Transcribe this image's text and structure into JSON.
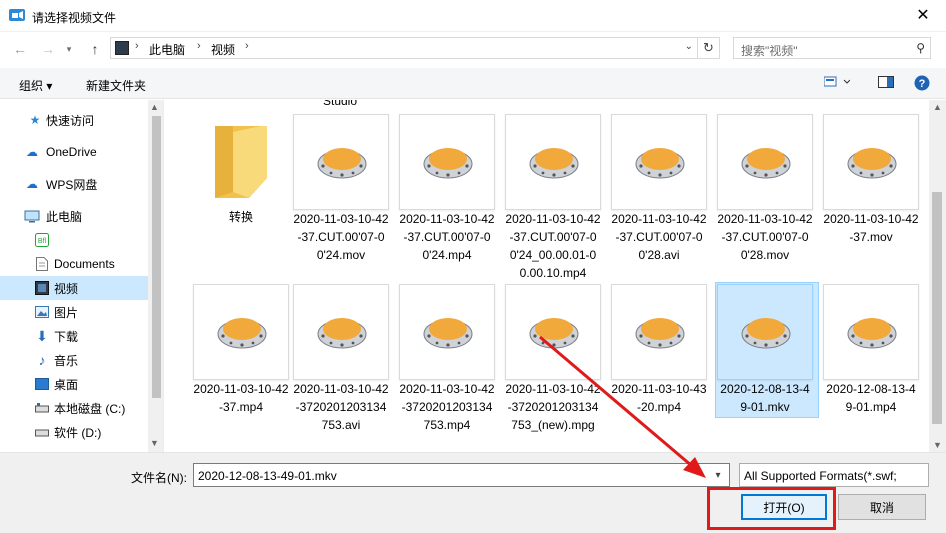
{
  "window": {
    "title": "请选择视频文件"
  },
  "address": {
    "path": [
      "此电脑",
      "视频"
    ]
  },
  "search": {
    "placeholder": "搜索\"视频\""
  },
  "commands": {
    "organize": "组织 ▾",
    "new_folder": "新建文件夹"
  },
  "sidebar": {
    "items": [
      {
        "label": "快速访问",
        "icon": "star-icon"
      },
      {
        "label": "OneDrive",
        "icon": "cloud-icon"
      },
      {
        "label": "WPS网盘",
        "icon": "cloud-icon"
      },
      {
        "label": "此电脑",
        "icon": "computer-icon"
      },
      {
        "label": "",
        "icon": "app-icon"
      },
      {
        "label": "Documents",
        "icon": "document-icon"
      },
      {
        "label": "视频",
        "icon": "video-icon",
        "selected": true
      },
      {
        "label": "图片",
        "icon": "picture-icon"
      },
      {
        "label": "下载",
        "icon": "download-icon"
      },
      {
        "label": "音乐",
        "icon": "music-icon"
      },
      {
        "label": "桌面",
        "icon": "desktop-icon"
      },
      {
        "label": "本地磁盘 (C:)",
        "icon": "drive-icon"
      },
      {
        "label": "软件 (D:)",
        "icon": "drive-icon"
      }
    ]
  },
  "partial_label_top": "Studio",
  "files": [
    {
      "name": "转换",
      "kind": "folder"
    },
    {
      "name": "2020-11-03-10-42-37.CUT.00'07-00'24.mov",
      "kind": "video"
    },
    {
      "name": "2020-11-03-10-42-37.CUT.00'07-00'24.mp4",
      "kind": "video"
    },
    {
      "name": "2020-11-03-10-42-37.CUT.00'07-00'24_00.00.01-00.00.10.mp4",
      "kind": "video"
    },
    {
      "name": "2020-11-03-10-42-37.CUT.00'07-00'28.avi",
      "kind": "video"
    },
    {
      "name": "2020-11-03-10-42-37.CUT.00'07-00'28.mov",
      "kind": "video"
    },
    {
      "name": "2020-11-03-10-42-37.mov",
      "kind": "video"
    },
    {
      "name": "2020-11-03-10-42-37.mp4",
      "kind": "video"
    },
    {
      "name": "2020-11-03-10-42-3720201203134753.avi",
      "kind": "video"
    },
    {
      "name": "2020-11-03-10-42-3720201203134753.mp4",
      "kind": "video"
    },
    {
      "name": "2020-11-03-10-42-3720201203134753_(new).mpg",
      "kind": "video"
    },
    {
      "name": "2020-11-03-10-43-20.mp4",
      "kind": "video"
    },
    {
      "name": "2020-12-08-13-49-01.mkv",
      "kind": "video",
      "selected": true
    },
    {
      "name": "2020-12-08-13-49-01.mp4",
      "kind": "video"
    }
  ],
  "footer": {
    "filename_label": "文件名(N):",
    "filename_value": "2020-12-08-13-49-01.mkv",
    "filetype_value": "All Supported Formats(*.swf;",
    "open_label": "打开(O)",
    "cancel_label": "取消"
  },
  "colors": {
    "selection": "#cce8ff",
    "accent": "#0078d7",
    "annotation": "#e01a1a",
    "folder": "#f7d774",
    "disc": "#f2a93b"
  }
}
